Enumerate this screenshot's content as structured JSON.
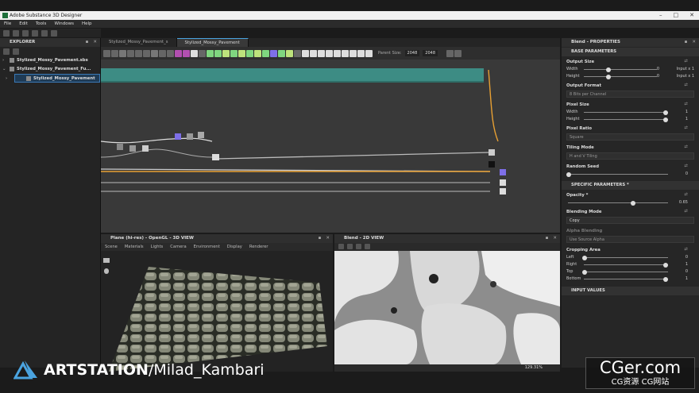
{
  "app": {
    "title": "Adobe Substance 3D Designer"
  },
  "menu": [
    "File",
    "Edit",
    "Tools",
    "Windows",
    "Help"
  ],
  "explorer": {
    "title": "EXPLORER",
    "items": [
      {
        "label": "Stylized_Mossy_Pavement.sbs"
      },
      {
        "label": "Stylized_Mossy_Pavement_Fu..."
      },
      {
        "label": "Stylized_Mossy_Pavement"
      }
    ]
  },
  "graph": {
    "tabs": [
      {
        "label": "Stylized_Mossy_Pavement_s"
      },
      {
        "label": "Stylized_Mossy_Pavement"
      }
    ],
    "parent_size_label": "Parent Size:",
    "parent_size_value": "2048",
    "size_value": "2048"
  },
  "view3d": {
    "title": "Plane (hi-res) - OpenGL - 3D VIEW",
    "menu": [
      "Scene",
      "Materials",
      "Lights",
      "Camera",
      "Environment",
      "Display",
      "Renderer"
    ]
  },
  "view2d": {
    "title": "Blend - 2D VIEW",
    "zoom": "129.31%"
  },
  "properties": {
    "title": "Blend - PROPERTIES",
    "base_header": "BASE PARAMETERS",
    "output_size": {
      "label": "Output Size",
      "width_label": "Width",
      "width_value": "0",
      "width_extra": "Input x 1",
      "height_label": "Height",
      "height_value": "0",
      "height_extra": "Input x 1"
    },
    "output_format": {
      "label": "Output Format",
      "value": "8 Bits per Channel"
    },
    "pixel_size": {
      "label": "Pixel Size",
      "width_label": "Width",
      "width_value": "1",
      "height_label": "Height",
      "height_value": "1"
    },
    "pixel_ratio": {
      "label": "Pixel Ratio",
      "value": "Square"
    },
    "tiling_mode": {
      "label": "Tiling Mode",
      "value": "H and V Tiling"
    },
    "random_seed": {
      "label": "Random Seed",
      "value": "0"
    },
    "specific_header": "SPECIFIC PARAMETERS *",
    "opacity": {
      "label": "Opacity *",
      "value": "0.65",
      "fraction": 0.65
    },
    "blending_mode": {
      "label": "Blending Mode",
      "value": "Copy"
    },
    "alpha_blending": {
      "label": "Alpha Blending",
      "value": "Use Source Alpha"
    },
    "cropping_area": {
      "label": "Cropping Area",
      "left_label": "Left",
      "left_value": "0",
      "right_label": "Right",
      "right_value": "1",
      "top_label": "Top",
      "top_value": "0",
      "bottom_label": "Bottom",
      "bottom_value": "1"
    },
    "input_header": "INPUT VALUES"
  },
  "watermark": {
    "brand": "ARTSTATION",
    "handle": "/Milad_Kambari"
  },
  "cger": {
    "big": "CGer.com",
    "small": "CG资源 CG网站"
  }
}
